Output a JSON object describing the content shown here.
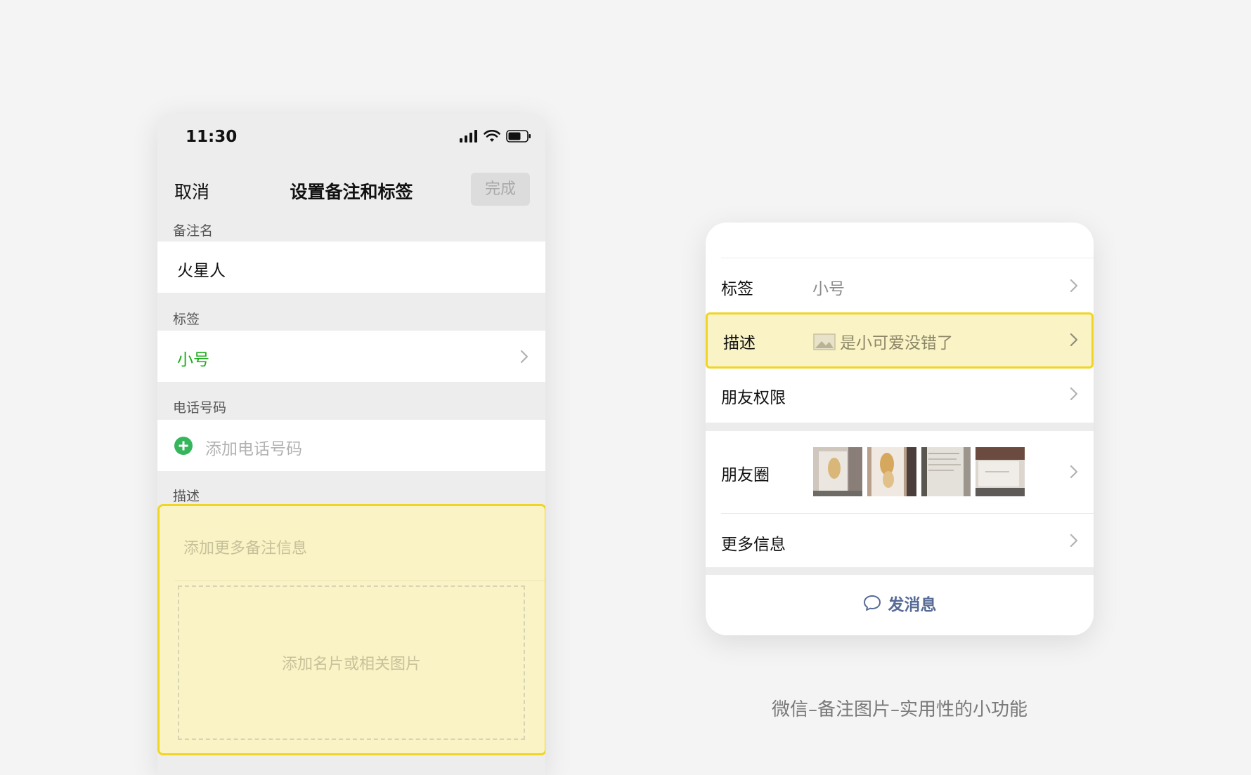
{
  "phone": {
    "status_bar": {
      "time": "11:30",
      "icons": [
        "signal-icon",
        "wifi-icon",
        "battery-icon"
      ]
    },
    "nav": {
      "cancel_label": "取消",
      "title": "设置备注和标签",
      "done_label": "完成"
    },
    "remark": {
      "section_label": "备注名",
      "value": "火星人"
    },
    "tags": {
      "section_label": "标签",
      "value": "小号"
    },
    "phone_number": {
      "section_label": "电话号码",
      "placeholder": "添加电话号码"
    },
    "description": {
      "section_label": "描述",
      "placeholder": "添加更多备注信息",
      "image_placeholder": "添加名片或相关图片"
    }
  },
  "profile_card": {
    "rows": {
      "tags_label": "标签",
      "tags_value": "小号",
      "description_label": "描述",
      "description_value": "是小可爱没错了",
      "permissions_label": "朋友权限",
      "moments_label": "朋友圈",
      "more_label": "更多信息"
    },
    "moments_thumbnails": 4,
    "send_message_label": "发消息"
  },
  "caption": "微信–备注图片–实用性的小功能",
  "colors": {
    "background": "#f4f4f4",
    "wechat_green": "#1aad19",
    "highlight_fill": "#faf3c6",
    "highlight_border": "#f0d526",
    "link_blue": "#576b95"
  }
}
